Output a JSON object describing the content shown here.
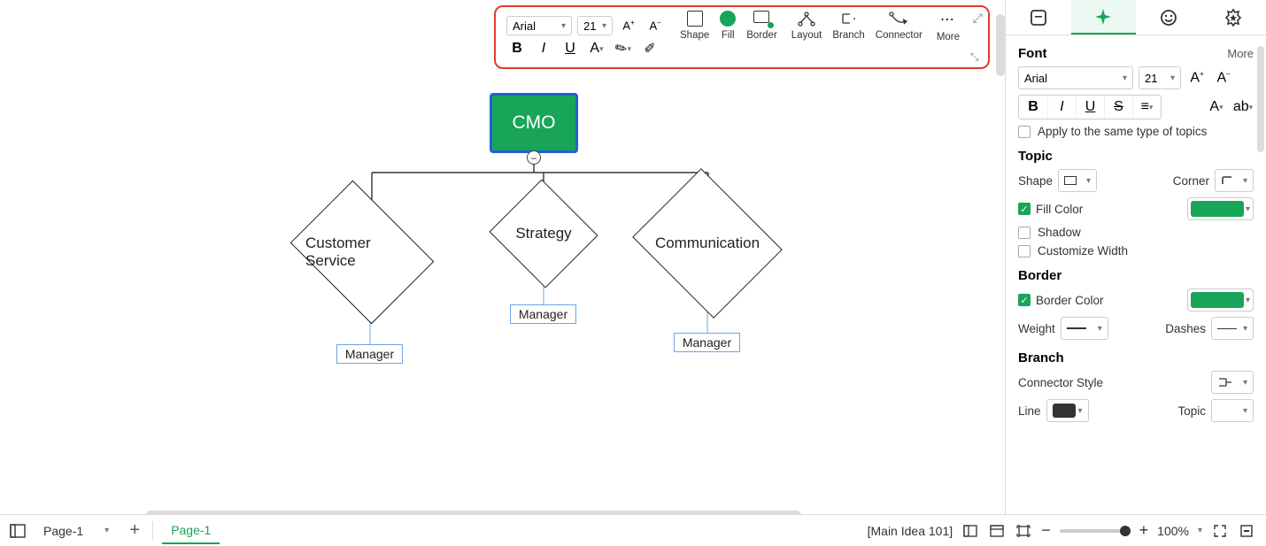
{
  "float_toolbar": {
    "font": "Arial",
    "size": "21",
    "groups": {
      "bold": "B",
      "italic": "I",
      "underline": "U",
      "shape": "Shape",
      "fill": "Fill",
      "border": "Border",
      "layout": "Layout",
      "branch": "Branch",
      "connector": "Connector",
      "more": "More"
    }
  },
  "diagram": {
    "root": "CMO",
    "children": [
      {
        "label": "Customer Service",
        "child": "Manager"
      },
      {
        "label": "Strategy",
        "child": "Manager"
      },
      {
        "label": "Communication",
        "child": "Manager"
      }
    ]
  },
  "right": {
    "font": {
      "title": "Font",
      "more": "More",
      "family": "Arial",
      "size": "21",
      "apply_same": "Apply to the same type of topics"
    },
    "topic": {
      "title": "Topic",
      "shape": "Shape",
      "corner": "Corner",
      "fill": "Fill Color",
      "fill_hex": "#18a558",
      "shadow": "Shadow",
      "custom_w": "Customize Width"
    },
    "border": {
      "title": "Border",
      "color": "Border Color",
      "color_hex": "#18a558",
      "weight": "Weight",
      "dashes": "Dashes"
    },
    "branch": {
      "title": "Branch",
      "conn_style": "Connector Style",
      "line": "Line",
      "line_hex": "#333333",
      "topic": "Topic"
    }
  },
  "bottom": {
    "page_dd": "Page-1",
    "page_tab": "Page-1",
    "context": "[Main Idea 101]",
    "zoom": "100%"
  }
}
